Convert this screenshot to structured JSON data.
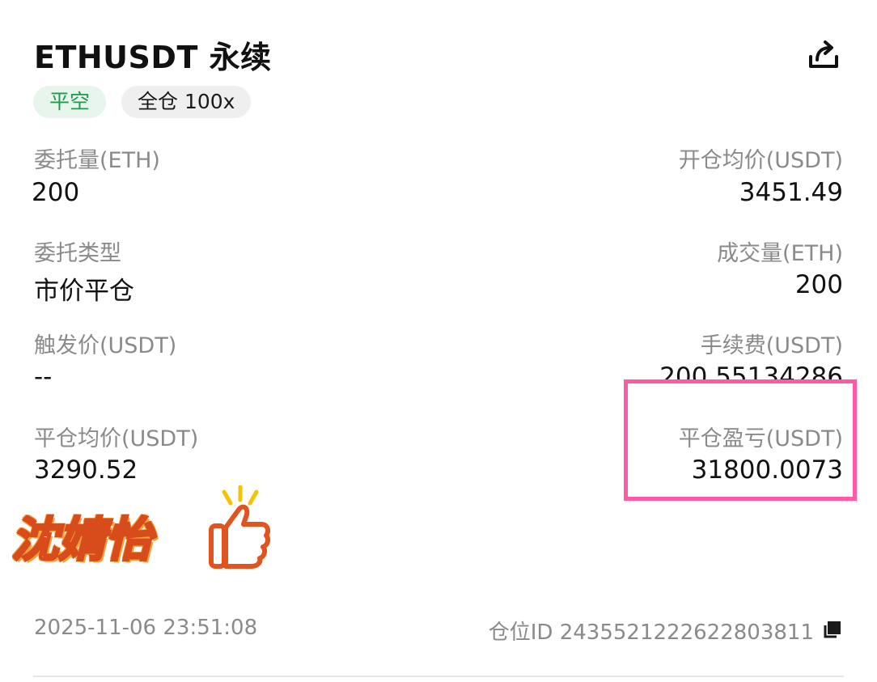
{
  "header": {
    "title": "ETHUSDT 永续",
    "share_icon": "share-icon"
  },
  "tags": {
    "side": "平空",
    "mode": "全仓 100x"
  },
  "fields": {
    "order_qty": {
      "label": "委托量(ETH)",
      "value": "200"
    },
    "open_avg_price": {
      "label": "开仓均价(USDT)",
      "value": "3451.49"
    },
    "order_type": {
      "label": "委托类型",
      "value": "市价平仓"
    },
    "filled_qty": {
      "label": "成交量(ETH)",
      "value": "200"
    },
    "trigger_price": {
      "label": "触发价(USDT)",
      "value": "--"
    },
    "fee": {
      "label": "手续费(USDT)",
      "value": "200.55134286"
    },
    "close_avg_price": {
      "label": "平仓均价(USDT)",
      "value": "3290.52"
    },
    "close_pnl": {
      "label": "平仓盈亏(USDT)",
      "value": "31800.0073"
    }
  },
  "overlay": {
    "stamp_text": "沈婧怡",
    "thumb_icon": "thumbs-up-icon"
  },
  "footer": {
    "timestamp": "2025-11-06 23:51:08",
    "position_id": "仓位ID 2435521222622803811",
    "copy_icon": "copy-icon"
  },
  "colors": {
    "accent_green": "#1f9a4f",
    "highlight_pink": "#ff5aa5"
  }
}
